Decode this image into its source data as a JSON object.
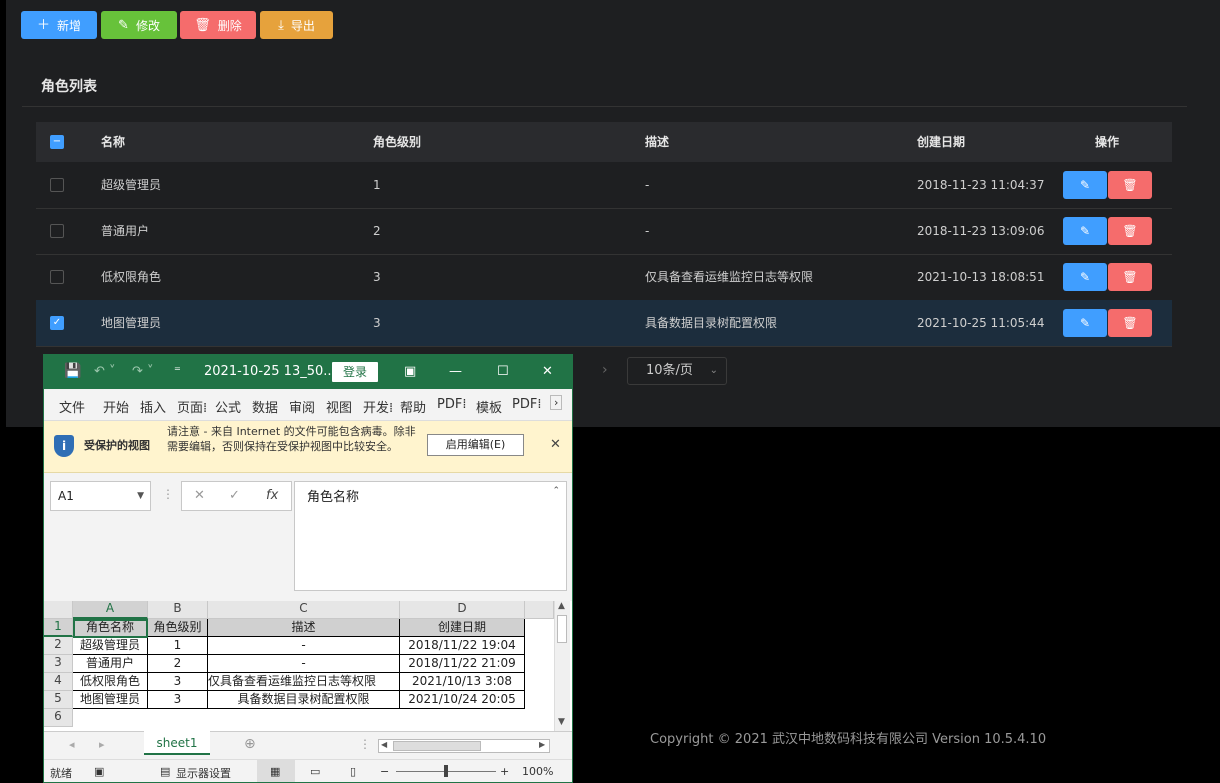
{
  "toolbar": {
    "add": {
      "label": "新增",
      "icon": "plus-icon",
      "color": "#409eff"
    },
    "edit": {
      "label": "修改",
      "icon": "pencil-icon",
      "color": "#67c23a"
    },
    "delete": {
      "label": "删除",
      "icon": "trash-icon",
      "color": "#f56c6c"
    },
    "export": {
      "label": "导出",
      "icon": "download-icon",
      "color": "#e6a23c"
    }
  },
  "card": {
    "title": "角色列表"
  },
  "table": {
    "headers": {
      "name": "名称",
      "level": "角色级别",
      "desc": "描述",
      "created": "创建日期",
      "ops": "操作"
    },
    "rows": [
      {
        "name": "超级管理员",
        "level": "1",
        "desc": "-",
        "created": "2018-11-23 11:04:37",
        "checked": false
      },
      {
        "name": "普通用户",
        "level": "2",
        "desc": "-",
        "created": "2018-11-23 13:09:06",
        "checked": false
      },
      {
        "name": "低权限角色",
        "level": "3",
        "desc": "仅具备查看运维监控日志等权限",
        "created": "2021-10-13 18:08:51",
        "checked": false
      },
      {
        "name": "地图管理员",
        "level": "3",
        "desc": "具备数据目录树配置权限",
        "created": "2021-10-25 11:05:44",
        "checked": true
      }
    ]
  },
  "pagination": {
    "page_size": "10条/页"
  },
  "footer": {
    "copyright": "Copyright © 2021 武汉中地数码科技有限公司 Version 10.5.4.10"
  },
  "excel": {
    "title": "2021-10-25 13_50...",
    "login": "登录",
    "menu": [
      "文件",
      "开始",
      "插入",
      "页面⁞",
      "公式",
      "数据",
      "审阅",
      "视图",
      "开发⁞",
      "帮助",
      "PDF⁞",
      "模板",
      "PDF⁞"
    ],
    "warning": {
      "title": "受保护的视图",
      "text": "请注意 - 来自 Internet 的文件可能包含病毒。除非需要编辑，否则保持在受保护视图中比较安全。",
      "button": "启用编辑(E)"
    },
    "namebox": "A1",
    "formula": "角色名称",
    "columns": [
      "A",
      "B",
      "C",
      "D"
    ],
    "row_numbers": [
      "1",
      "2",
      "3",
      "4",
      "5",
      "6"
    ],
    "cells": [
      [
        "角色名称",
        "角色级别",
        "描述",
        "创建日期"
      ],
      [
        "超级管理员",
        "1",
        "-",
        "2018/11/22 19:04"
      ],
      [
        "普通用户",
        "2",
        "-",
        "2018/11/22 21:09"
      ],
      [
        "低权限角色",
        "3",
        "仅具备查看运维监控日志等权限",
        "2021/10/13 3:08"
      ],
      [
        "地图管理员",
        "3",
        "具备数据目录树配置权限",
        "2021/10/24 20:05"
      ]
    ],
    "sheet": "sheet1",
    "status": {
      "ready": "就绪",
      "display": "显示器设置",
      "zoom": "100%"
    }
  }
}
